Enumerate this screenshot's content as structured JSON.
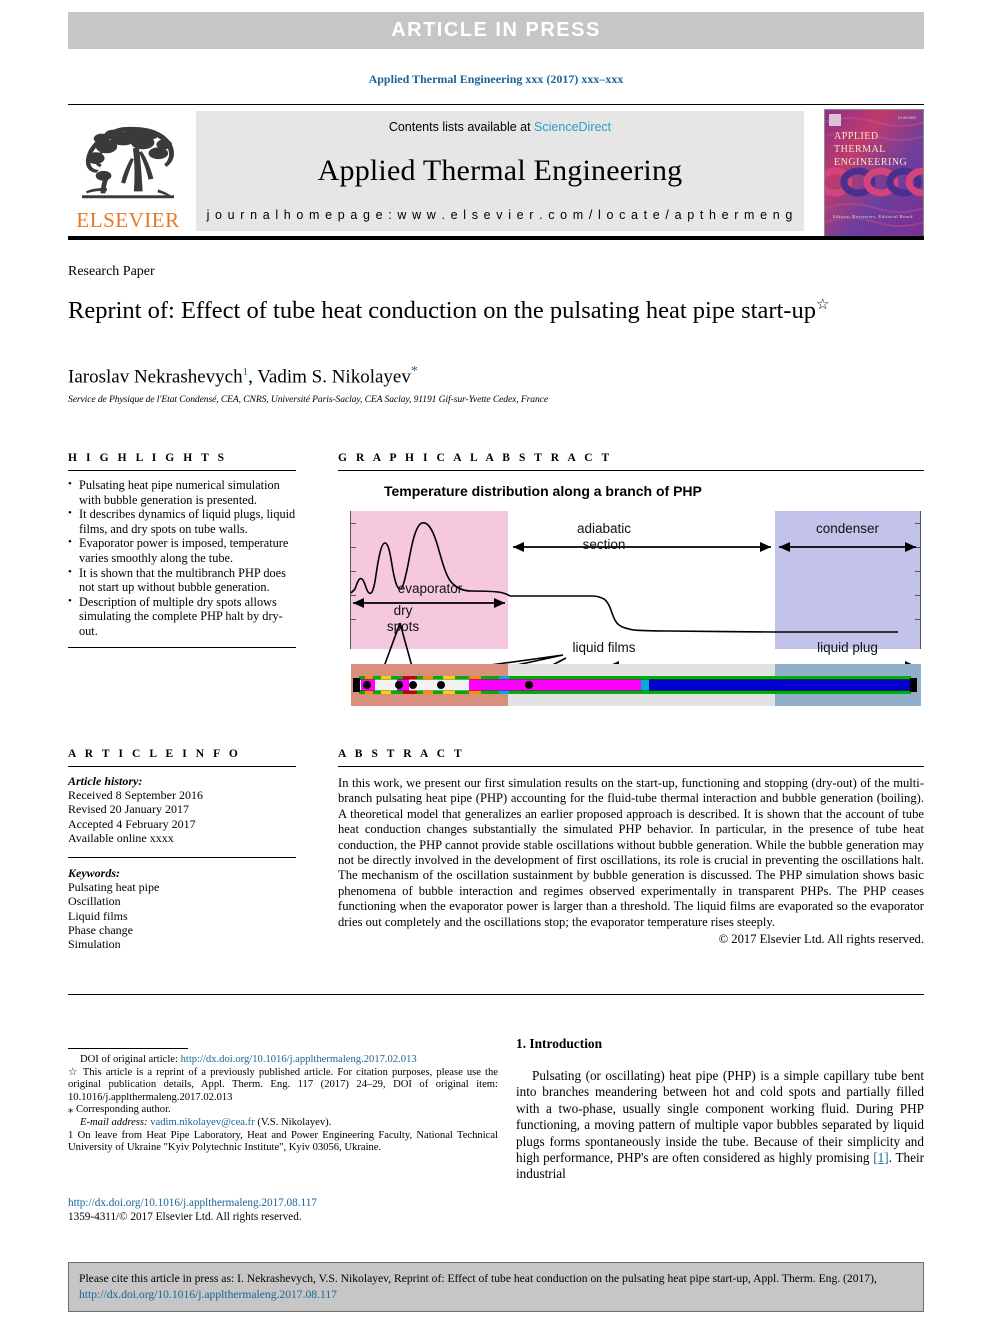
{
  "banner": {
    "text": "ARTICLE  IN  PRESS"
  },
  "running_head": "Applied Thermal Engineering xxx (2017) xxx–xxx",
  "masthead": {
    "contents_prefix": "Contents lists available at ",
    "contents_link": "ScienceDirect",
    "journal_name": "Applied Thermal Engineering",
    "homepage": "j o u r n a l   h o m e p a g e :   w w w . e l s e v i e r . c o m / l o c a t e / a p t h e r m e n g",
    "publisher": "ELSEVIER",
    "cover_title": "APPLIED\nTHERMAL\nENGINEERING",
    "cover_footer": "Editors: Reviewers, Editorial Board"
  },
  "article": {
    "type_label": "Research Paper",
    "title": "Reprint of: Effect of tube heat conduction on the pulsating heat pipe start-up",
    "title_marker": "☆",
    "authors_part1": "Iaroslav Nekrashevych",
    "authors_sup1": "1",
    "authors_part2": ", Vadim S. Nikolayev",
    "authors_star": "*",
    "affiliation": "Service de Physique de l'Etat Condensé, CEA, CNRS, Université Paris-Saclay, CEA Saclay, 91191 Gif-sur-Yvette Cedex, France"
  },
  "highlights": {
    "heading": "H I G H L I G H T S",
    "items": [
      "Pulsating heat pipe numerical simulation with bubble generation is presented.",
      "It describes dynamics of liquid plugs, liquid films, and dry spots on tube walls.",
      "Evaporator power is imposed, temperature varies smoothly along the tube.",
      "It is shown that the multibranch PHP does not start up without bubble generation.",
      "Description of multiple dry spots allows simulating the complete PHP halt by dry-out."
    ]
  },
  "graphical_abstract": {
    "heading": "G R A P H I C A L   A B S T R A C T",
    "figure_title": "Temperature distribution along a branch of PHP",
    "labels": {
      "evaporator": "evaporator",
      "adiabatic": "adiabatic\nsection",
      "adiabatic_l1": "adiabatic",
      "adiabatic_l2": "section",
      "condenser": "condenser",
      "dry_spots_l1": "dry",
      "dry_spots_l2": "spots",
      "liquid_films": "liquid films",
      "liquid_plug": "liquid plug"
    },
    "colors": {
      "evaporator_zone": "#f5c8dd",
      "condenser_zone": "#c2c2ea",
      "evaporator_band": "#d98f7e",
      "adiabatic_band": "#e2e2e2",
      "condenser_band": "#8fafcb",
      "vapor_plug": "#ff00ff",
      "liquid_plug": "#0000cc",
      "film_green": "#00b000"
    }
  },
  "article_info": {
    "heading": "A R T I C L E   I N F O",
    "history_label": "Article history:",
    "history": [
      "Received 8 September 2016",
      "Revised 20 January 2017",
      "Accepted 4 February 2017",
      "Available online xxxx"
    ],
    "keywords_label": "Keywords:",
    "keywords": [
      "Pulsating heat pipe",
      "Oscillation",
      "Liquid films",
      "Phase change",
      "Simulation"
    ]
  },
  "abstract": {
    "heading": "A B S T R A C T",
    "text": "In this work, we present our first simulation results on the start-up, functioning and stopping (dry-out) of the multi-branch pulsating heat pipe (PHP) accounting for the fluid-tube thermal interaction and bubble generation (boiling). A theoretical model that generalizes an earlier proposed approach is described. It is shown that the account of tube heat conduction changes substantially the simulated PHP behavior. In particular, in the presence of tube heat conduction, the PHP cannot provide stable oscillations without bubble generation. While the bubble generation may not be directly involved in the development of first oscillations, its role is crucial in preventing the oscillations halt. The mechanism of the oscillation sustainment by bubble generation is discussed. The PHP simulation shows basic phenomena of bubble interaction and regimes observed experimentally in transparent PHPs. The PHP ceases functioning when the evaporator power is larger than a threshold. The liquid films are evaporated so the evaporator dries out completely and the oscillations stop; the evaporator temperature rises steeply.",
    "copyright": "© 2017 Elsevier Ltd. All rights reserved."
  },
  "footnotes": {
    "doi_label": "DOI of original article: ",
    "doi_link": "http://dx.doi.org/10.1016/j.applthermaleng.2017.02.013",
    "star_note": "☆ This article is a reprint of a previously published article. For citation purposes, please use the original publication details, Appl. Therm. Eng. 117 (2017) 24–29, DOI of original item: 10.1016/j.applthermaleng.2017.02.013",
    "corresponding": "⁎ Corresponding author.",
    "email_label": "E-mail address: ",
    "email_link": "vadim.nikolayev@cea.fr",
    "email_suffix": " (V.S. Nikolayev).",
    "onleave": "1 On leave from Heat Pipe Laboratory, Heat and Power Engineering Faculty, National Technical University of Ukraine \"Kyiv Polytechnic Institute\", Kyiv 03056, Ukraine."
  },
  "issn_block": {
    "doi_link": "http://dx.doi.org/10.1016/j.applthermaleng.2017.08.117",
    "issn_line": "1359-4311/© 2017 Elsevier Ltd. All rights reserved."
  },
  "introduction": {
    "heading": "1. Introduction",
    "paragraph_a": "Pulsating (or oscillating) heat pipe (PHP) is a simple capillary tube bent into branches meandering between hot and cold spots and partially filled with a two-phase, usually single component working fluid. During PHP functioning, a moving pattern of multiple vapor bubbles separated by liquid plugs forms spontaneously inside the tube. Because of their simplicity and high performance, PHP's are often considered as highly promising ",
    "ref": "[1]",
    "paragraph_b": ". Their industrial"
  },
  "cite_bar": {
    "prefix": "Please cite this article in press as: I. Nekrashevych, V.S. Nikolayev, Reprint of: Effect of tube heat conduction on the pulsating heat pipe start-up, Appl. Therm. Eng. (2017), ",
    "link": "http://dx.doi.org/10.1016/j.applthermaleng.2017.08.117"
  },
  "colors": {
    "link": "#1a6496",
    "banner_bg": "#c6c6c6",
    "masthead_bg": "#e6e6e6",
    "elsevier_orange": "#e87722"
  }
}
